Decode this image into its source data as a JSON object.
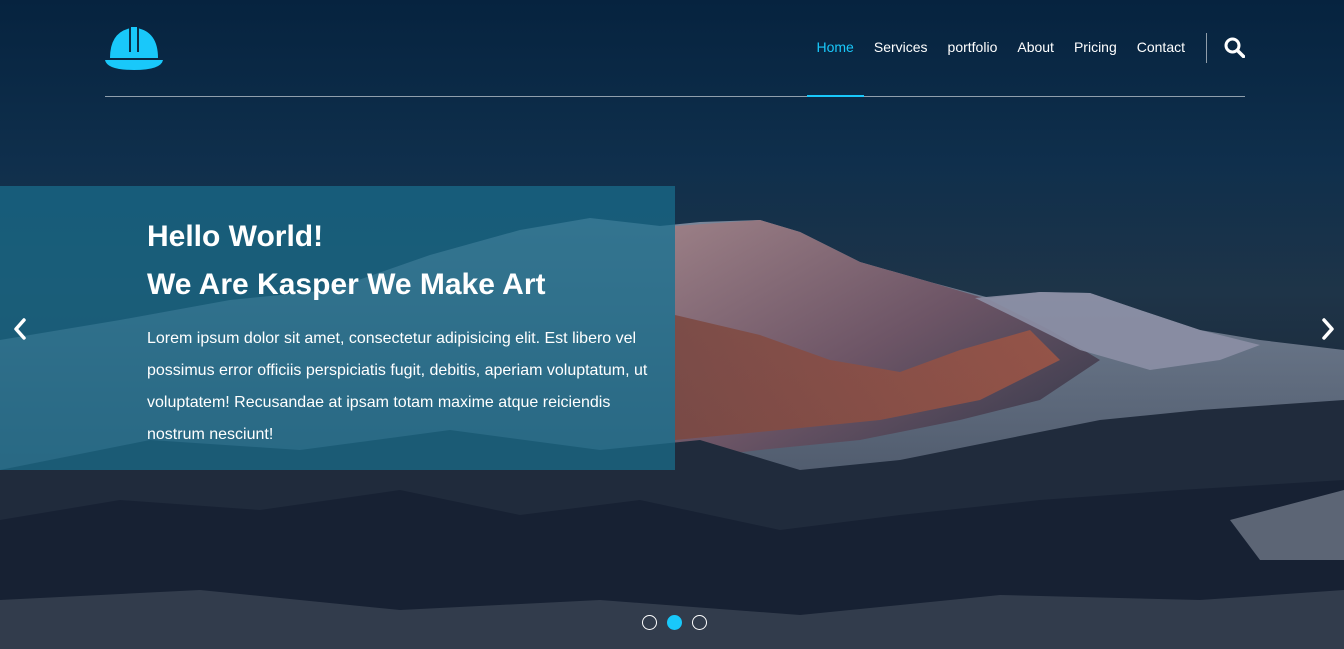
{
  "brand": {
    "logo_icon": "hard-hat-icon",
    "accent_color": "#19c8fa"
  },
  "nav": {
    "items": [
      {
        "label": "Home",
        "active": true
      },
      {
        "label": "Services",
        "active": false
      },
      {
        "label": "portfolio",
        "active": false
      },
      {
        "label": "About",
        "active": false
      },
      {
        "label": "Pricing",
        "active": false
      },
      {
        "label": "Contact",
        "active": false
      }
    ],
    "search_icon": "search-icon"
  },
  "slider": {
    "title_line1": "Hello World!",
    "title_line2": "We Are Kasper We Make Art",
    "text": "Lorem ipsum dolor sit amet, consectetur adipisicing elit. Est libero vel possimus error officiis perspiciatis fugit, debitis, aperiam voluptatum, ut voluptatem! Recusandae at ipsam totam maxime atque reiciendis nostrum nesciunt!",
    "prev_icon": "chevron-left-icon",
    "next_icon": "chevron-right-icon",
    "bullets": [
      false,
      true,
      false
    ]
  }
}
